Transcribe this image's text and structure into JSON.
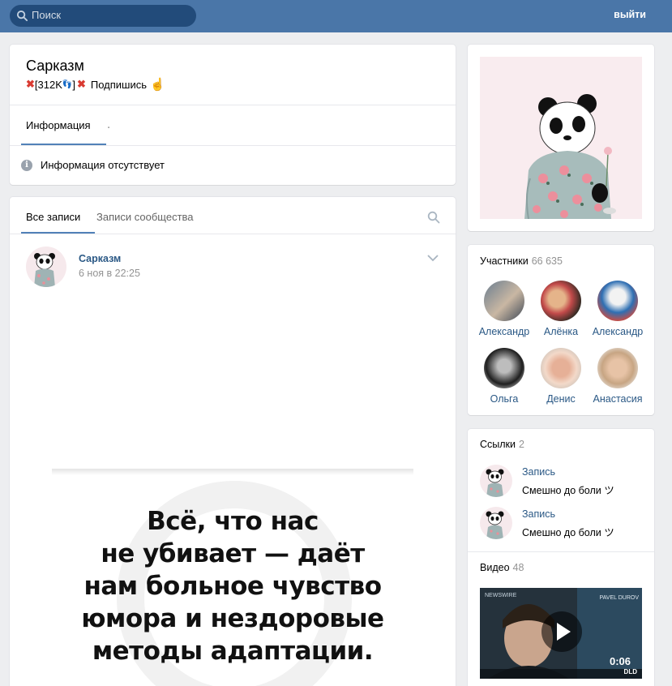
{
  "header": {
    "search_placeholder": "Поиск",
    "logout_label": "выйти"
  },
  "group": {
    "name": "Сарказм",
    "status": {
      "count_text": "[312K",
      "close_bracket": "]",
      "subscribe_text": "Подпишись"
    },
    "tabs": [
      {
        "label": "Информация"
      },
      {
        "label": "."
      }
    ],
    "info_empty_text": "Информация отсутствует"
  },
  "wall": {
    "tabs": [
      {
        "label": "Все записи"
      },
      {
        "label": "Записи сообщества"
      }
    ],
    "post": {
      "author": "Сарказм",
      "date": "6 ноя в 22:25",
      "quote_lines": [
        "Всё, что нас",
        "не убивает — даёт",
        "нам больное чувство",
        "юмора и нездоровые",
        "методы адаптации."
      ]
    }
  },
  "members": {
    "title": "Участники",
    "count": "66 635",
    "items": [
      {
        "name": "Александр"
      },
      {
        "name": "Алёнка"
      },
      {
        "name": "Александр"
      },
      {
        "name": "Ольга"
      },
      {
        "name": "Денис"
      },
      {
        "name": "Анастасия"
      }
    ]
  },
  "links": {
    "title": "Ссылки",
    "count": "2",
    "items": [
      {
        "title": "Запись",
        "desc": "Смешно до боли ツ"
      },
      {
        "title": "Запись",
        "desc": "Смешно до боли ツ"
      }
    ]
  },
  "videos": {
    "title": "Видео",
    "count": "48",
    "first": {
      "duration": "0:06",
      "badge": "NEWSWIRE",
      "side_text": "PAVEL DUROV",
      "logo": "DLD"
    }
  },
  "colors": {
    "topbar": "#4a76a8",
    "link": "#2a5885",
    "accent": "#5181b8",
    "background": "#edeef0"
  },
  "icons": [
    "search-icon",
    "info-icon",
    "chevron-down-icon",
    "play-icon"
  ]
}
